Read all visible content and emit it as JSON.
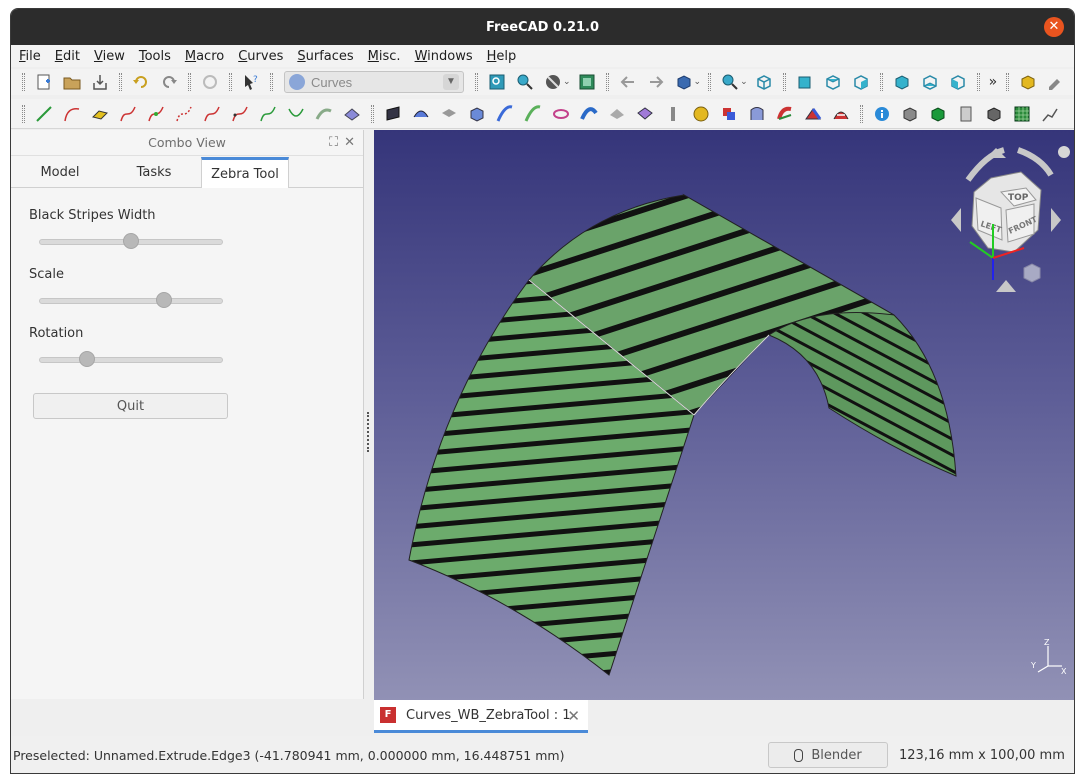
{
  "window": {
    "title": "FreeCAD 0.21.0",
    "close_glyph": "✕"
  },
  "menu": [
    "File",
    "Edit",
    "View",
    "Tools",
    "Macro",
    "Curves",
    "Surfaces",
    "Misc.",
    "Windows",
    "Help"
  ],
  "toolbar": {
    "workbench": "Curves",
    "overflow": "»"
  },
  "combo": {
    "title": "Combo View",
    "tabs": [
      "Model",
      "Tasks",
      "Zebra Tool"
    ],
    "active_tab": "Zebra Tool",
    "sliders": [
      {
        "label": "Black Stripes Width",
        "value": 0.5
      },
      {
        "label": "Scale",
        "value": 0.68
      },
      {
        "label": "Rotation",
        "value": 0.26
      }
    ],
    "quit_label": "Quit"
  },
  "viewport": {
    "navcube_faces": [
      "LEFT",
      "FRONT",
      "TOP"
    ],
    "axes": [
      "Z",
      "Y",
      "X"
    ],
    "surface_color": "#6aa36a",
    "stripe_color": "#111111"
  },
  "doc_tab": {
    "label": "Curves_WB_ZebraTool : 1",
    "icon_text": "F"
  },
  "status": {
    "message": "Preselected: Unnamed.Extrude.Edge3 (-41.780941 mm, 0.000000 mm, 16.448751 mm)",
    "nav_style": "Blender",
    "dimensions": "123,16 mm x 100,00 mm"
  },
  "colors": {
    "accent": "#4a8ad8",
    "titlebar": "#2c2c2c",
    "close": "#e9541f"
  }
}
